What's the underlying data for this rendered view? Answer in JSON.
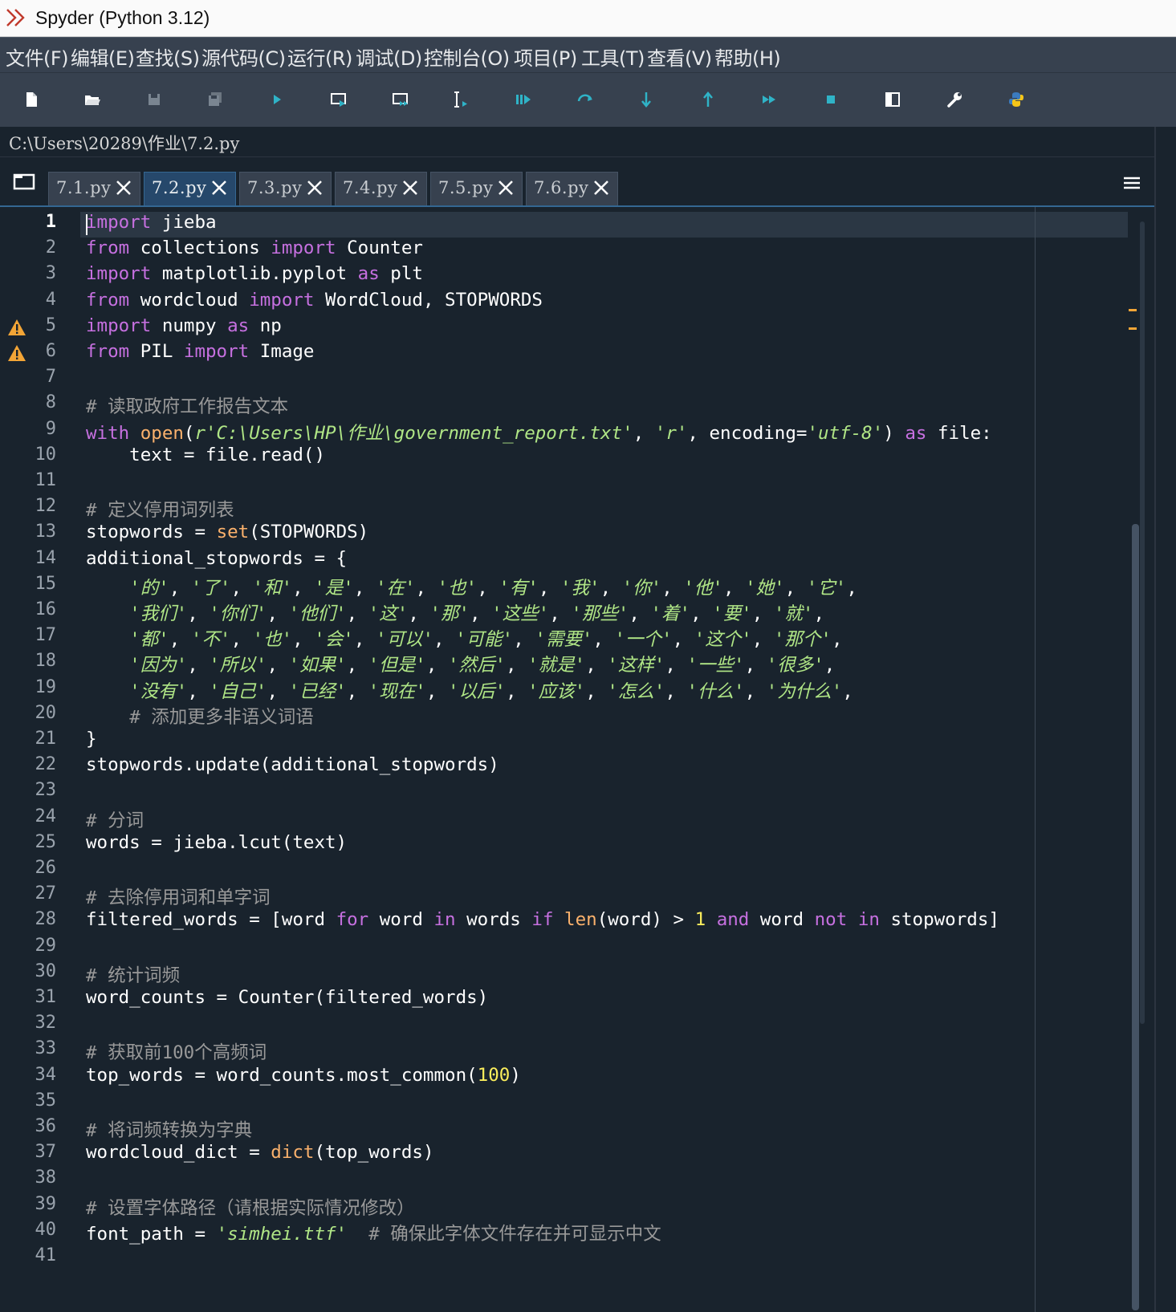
{
  "window": {
    "title": "Spyder (Python 3.12)"
  },
  "menu": [
    "文件(F)",
    "编辑(E)",
    "查找(S)",
    "源代码(C)",
    "运行(R)",
    "调试(D)",
    "控制台(O)",
    "项目(P)",
    "工具(T)",
    "查看(V)",
    "帮助(H)"
  ],
  "toolbar": {
    "buttons": [
      "new-file-icon",
      "open-file-icon",
      "save-icon",
      "save-all-icon",
      "run-icon",
      "run-cell-icon",
      "run-cell-advance-icon",
      "run-selection-icon",
      "debug-icon",
      "step-icon",
      "step-into-icon",
      "step-return-icon",
      "continue-icon",
      "stop-icon",
      "maximize-pane-icon",
      "preferences-icon",
      "python-path-icon"
    ]
  },
  "editor": {
    "file_path": "C:\\Users\\20289\\作业\\7.2.py",
    "tabs": [
      {
        "label": "7.1.py",
        "active": false
      },
      {
        "label": "7.2.py",
        "active": true
      },
      {
        "label": "7.3.py",
        "active": false
      },
      {
        "label": "7.4.py",
        "active": false
      },
      {
        "label": "7.5.py",
        "active": false
      },
      {
        "label": "7.6.py",
        "active": false
      }
    ],
    "current_line": 1,
    "warning_lines": [
      5,
      6
    ],
    "line_numbers": [
      "1",
      "2",
      "3",
      "4",
      "5",
      "6",
      "7",
      "8",
      "9",
      "10",
      "11",
      "12",
      "13",
      "14",
      "15",
      "16",
      "17",
      "18",
      "19",
      "20",
      "21",
      "22",
      "23",
      "24",
      "25",
      "26",
      "27",
      "28",
      "29",
      "30",
      "31",
      "32",
      "33",
      "34",
      "35",
      "36",
      "37",
      "38",
      "39",
      "40",
      "41"
    ],
    "code_lines": [
      "import jieba",
      "from collections import Counter",
      "import matplotlib.pyplot as plt",
      "from wordcloud import WordCloud, STOPWORDS",
      "import numpy as np",
      "from PIL import Image",
      "",
      "# 读取政府工作报告文本",
      "with open(r'C:\\Users\\HP\\作业\\government_report.txt', 'r', encoding='utf-8') as file:",
      "    text = file.read()",
      "",
      "# 定义停用词列表",
      "stopwords = set(STOPWORDS)",
      "additional_stopwords = {",
      "    '的', '了', '和', '是', '在', '也', '有', '我', '你', '他', '她', '它',",
      "    '我们', '你们', '他们', '这', '那', '这些', '那些', '着', '要', '就',",
      "    '都', '不', '也', '会', '可以', '可能', '需要', '一个', '这个', '那个',",
      "    '因为', '所以', '如果', '但是', '然后', '就是', '这样', '一些', '很多',",
      "    '没有', '自己', '已经', '现在', '以后', '应该', '怎么', '什么', '为什么',",
      "    # 添加更多非语义词语",
      "}",
      "stopwords.update(additional_stopwords)",
      "",
      "# 分词",
      "words = jieba.lcut(text)",
      "",
      "# 去除停用词和单字词",
      "filtered_words = [word for word in words if len(word) > 1 and word not in stopwords]",
      "",
      "# 统计词频",
      "word_counts = Counter(filtered_words)",
      "",
      "# 获取前100个高频词",
      "top_words = word_counts.most_common(100)",
      "",
      "# 将词频转换为字典",
      "wordcloud_dict = dict(top_words)",
      "",
      "# 设置字体路径（请根据实际情况修改）",
      "font_path = 'simhei.ttf'  # 确保此字体文件存在并可显示中文",
      ""
    ]
  },
  "colors": {
    "background": "#19232d",
    "keyword": "#c670e0",
    "builtin": "#fab16c",
    "string": "#b0e686",
    "comment": "#999999",
    "number": "#faed5c",
    "warning": "#f3a536"
  }
}
